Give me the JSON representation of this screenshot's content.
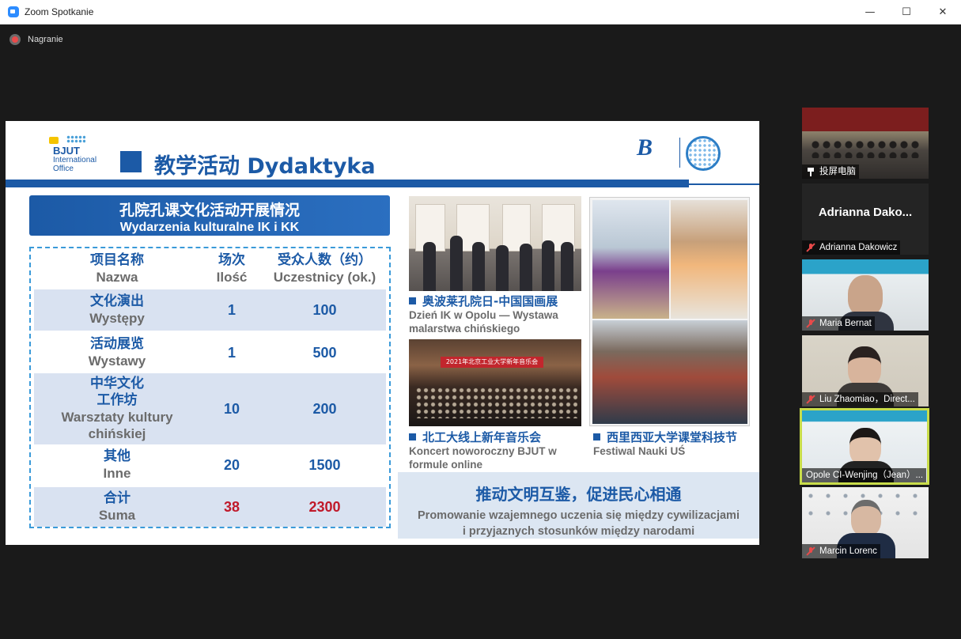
{
  "window": {
    "title": "Zoom Spotkanie",
    "minimize": "—",
    "maximize": "☐",
    "close": "✕"
  },
  "recording": {
    "label": "Nagranie"
  },
  "slide": {
    "logo_left": {
      "line1": "BJUT",
      "line2": "International",
      "line3": "Office"
    },
    "title": "教学活动 Dydaktyka",
    "section_header": {
      "zh": "孔院孔课文化活动开展情况",
      "pl": "Wydarzenia kulturalne IK i KK"
    },
    "table": {
      "headers": [
        {
          "zh": "项目名称",
          "pl": "Nazwa"
        },
        {
          "zh": "场次",
          "pl": "Ilość"
        },
        {
          "zh": "受众人数（约）",
          "pl": "Uczestnicy (ok.)"
        }
      ],
      "rows": [
        {
          "zh": "文化演出",
          "pl": "Występy",
          "count": "1",
          "audience": "100"
        },
        {
          "zh": "活动展览",
          "pl": "Wystawy",
          "count": "1",
          "audience": "500"
        },
        {
          "zh": "中华文化\n工作坊",
          "zh1": "中华文化",
          "zh2": "工作坊",
          "pl1": "Warsztaty kultury",
          "pl2": "chińskiej",
          "count": "10",
          "audience": "200"
        },
        {
          "zh": "其他",
          "pl": "Inne",
          "count": "20",
          "audience": "1500"
        },
        {
          "zh": "合计",
          "pl": "Suma",
          "count": "38",
          "audience": "2300"
        }
      ]
    },
    "captions": {
      "exhibition": {
        "zh": "奥波莱孔院日-中国国画展",
        "pl1": "Dzień IK w Opolu — Wystawa",
        "pl2": "malarstwa chińskiego"
      },
      "concert": {
        "zh": "北工大线上新年音乐会",
        "pl1": "Koncert noworoczny BJUT w",
        "pl2": "formule online"
      },
      "science": {
        "zh": "西里西亚大学课堂科技节",
        "pl1": "Festiwal Nauki UŚ"
      }
    },
    "concert_banner": "2021年北京工业大学新年音乐会",
    "slogan": {
      "zh": "推动文明互鉴，促进民心相通",
      "pl1": "Promowanie wzajemnego uczenia się między cywilizacjami",
      "pl2": "i przyjaznych stosunków między narodami"
    },
    "colors": {
      "brand_blue": "#1c5aa6",
      "table_alt": "#d9e2f1",
      "total_red": "#c0192a"
    }
  },
  "participants": [
    {
      "name": "投屏电脑",
      "mic": "pin-icon"
    },
    {
      "display": "Adrianna  Dako...",
      "name": "Adrianna Dakowicz",
      "mic": "muted"
    },
    {
      "name": "Maria Bernat",
      "mic": "muted"
    },
    {
      "name": "Liu Zhaomiao，Direct...",
      "mic": "muted"
    },
    {
      "name": "Opole CI-Wenjing（Jean）...",
      "active": true
    },
    {
      "name": "Marcin Lorenc",
      "mic": "muted"
    }
  ]
}
